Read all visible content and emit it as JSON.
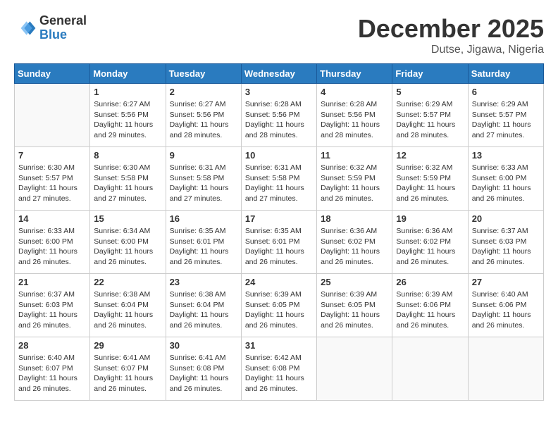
{
  "header": {
    "logo_general": "General",
    "logo_blue": "Blue",
    "month_year": "December 2025",
    "location": "Dutse, Jigawa, Nigeria"
  },
  "weekdays": [
    "Sunday",
    "Monday",
    "Tuesday",
    "Wednesday",
    "Thursday",
    "Friday",
    "Saturday"
  ],
  "weeks": [
    [
      {
        "day": "",
        "info": ""
      },
      {
        "day": "1",
        "info": "Sunrise: 6:27 AM\nSunset: 5:56 PM\nDaylight: 11 hours\nand 29 minutes."
      },
      {
        "day": "2",
        "info": "Sunrise: 6:27 AM\nSunset: 5:56 PM\nDaylight: 11 hours\nand 28 minutes."
      },
      {
        "day": "3",
        "info": "Sunrise: 6:28 AM\nSunset: 5:56 PM\nDaylight: 11 hours\nand 28 minutes."
      },
      {
        "day": "4",
        "info": "Sunrise: 6:28 AM\nSunset: 5:56 PM\nDaylight: 11 hours\nand 28 minutes."
      },
      {
        "day": "5",
        "info": "Sunrise: 6:29 AM\nSunset: 5:57 PM\nDaylight: 11 hours\nand 28 minutes."
      },
      {
        "day": "6",
        "info": "Sunrise: 6:29 AM\nSunset: 5:57 PM\nDaylight: 11 hours\nand 27 minutes."
      }
    ],
    [
      {
        "day": "7",
        "info": "Sunrise: 6:30 AM\nSunset: 5:57 PM\nDaylight: 11 hours\nand 27 minutes."
      },
      {
        "day": "8",
        "info": "Sunrise: 6:30 AM\nSunset: 5:58 PM\nDaylight: 11 hours\nand 27 minutes."
      },
      {
        "day": "9",
        "info": "Sunrise: 6:31 AM\nSunset: 5:58 PM\nDaylight: 11 hours\nand 27 minutes."
      },
      {
        "day": "10",
        "info": "Sunrise: 6:31 AM\nSunset: 5:58 PM\nDaylight: 11 hours\nand 27 minutes."
      },
      {
        "day": "11",
        "info": "Sunrise: 6:32 AM\nSunset: 5:59 PM\nDaylight: 11 hours\nand 26 minutes."
      },
      {
        "day": "12",
        "info": "Sunrise: 6:32 AM\nSunset: 5:59 PM\nDaylight: 11 hours\nand 26 minutes."
      },
      {
        "day": "13",
        "info": "Sunrise: 6:33 AM\nSunset: 6:00 PM\nDaylight: 11 hours\nand 26 minutes."
      }
    ],
    [
      {
        "day": "14",
        "info": "Sunrise: 6:33 AM\nSunset: 6:00 PM\nDaylight: 11 hours\nand 26 minutes."
      },
      {
        "day": "15",
        "info": "Sunrise: 6:34 AM\nSunset: 6:00 PM\nDaylight: 11 hours\nand 26 minutes."
      },
      {
        "day": "16",
        "info": "Sunrise: 6:35 AM\nSunset: 6:01 PM\nDaylight: 11 hours\nand 26 minutes."
      },
      {
        "day": "17",
        "info": "Sunrise: 6:35 AM\nSunset: 6:01 PM\nDaylight: 11 hours\nand 26 minutes."
      },
      {
        "day": "18",
        "info": "Sunrise: 6:36 AM\nSunset: 6:02 PM\nDaylight: 11 hours\nand 26 minutes."
      },
      {
        "day": "19",
        "info": "Sunrise: 6:36 AM\nSunset: 6:02 PM\nDaylight: 11 hours\nand 26 minutes."
      },
      {
        "day": "20",
        "info": "Sunrise: 6:37 AM\nSunset: 6:03 PM\nDaylight: 11 hours\nand 26 minutes."
      }
    ],
    [
      {
        "day": "21",
        "info": "Sunrise: 6:37 AM\nSunset: 6:03 PM\nDaylight: 11 hours\nand 26 minutes."
      },
      {
        "day": "22",
        "info": "Sunrise: 6:38 AM\nSunset: 6:04 PM\nDaylight: 11 hours\nand 26 minutes."
      },
      {
        "day": "23",
        "info": "Sunrise: 6:38 AM\nSunset: 6:04 PM\nDaylight: 11 hours\nand 26 minutes."
      },
      {
        "day": "24",
        "info": "Sunrise: 6:39 AM\nSunset: 6:05 PM\nDaylight: 11 hours\nand 26 minutes."
      },
      {
        "day": "25",
        "info": "Sunrise: 6:39 AM\nSunset: 6:05 PM\nDaylight: 11 hours\nand 26 minutes."
      },
      {
        "day": "26",
        "info": "Sunrise: 6:39 AM\nSunset: 6:06 PM\nDaylight: 11 hours\nand 26 minutes."
      },
      {
        "day": "27",
        "info": "Sunrise: 6:40 AM\nSunset: 6:06 PM\nDaylight: 11 hours\nand 26 minutes."
      }
    ],
    [
      {
        "day": "28",
        "info": "Sunrise: 6:40 AM\nSunset: 6:07 PM\nDaylight: 11 hours\nand 26 minutes."
      },
      {
        "day": "29",
        "info": "Sunrise: 6:41 AM\nSunset: 6:07 PM\nDaylight: 11 hours\nand 26 minutes."
      },
      {
        "day": "30",
        "info": "Sunrise: 6:41 AM\nSunset: 6:08 PM\nDaylight: 11 hours\nand 26 minutes."
      },
      {
        "day": "31",
        "info": "Sunrise: 6:42 AM\nSunset: 6:08 PM\nDaylight: 11 hours\nand 26 minutes."
      },
      {
        "day": "",
        "info": ""
      },
      {
        "day": "",
        "info": ""
      },
      {
        "day": "",
        "info": ""
      }
    ]
  ]
}
